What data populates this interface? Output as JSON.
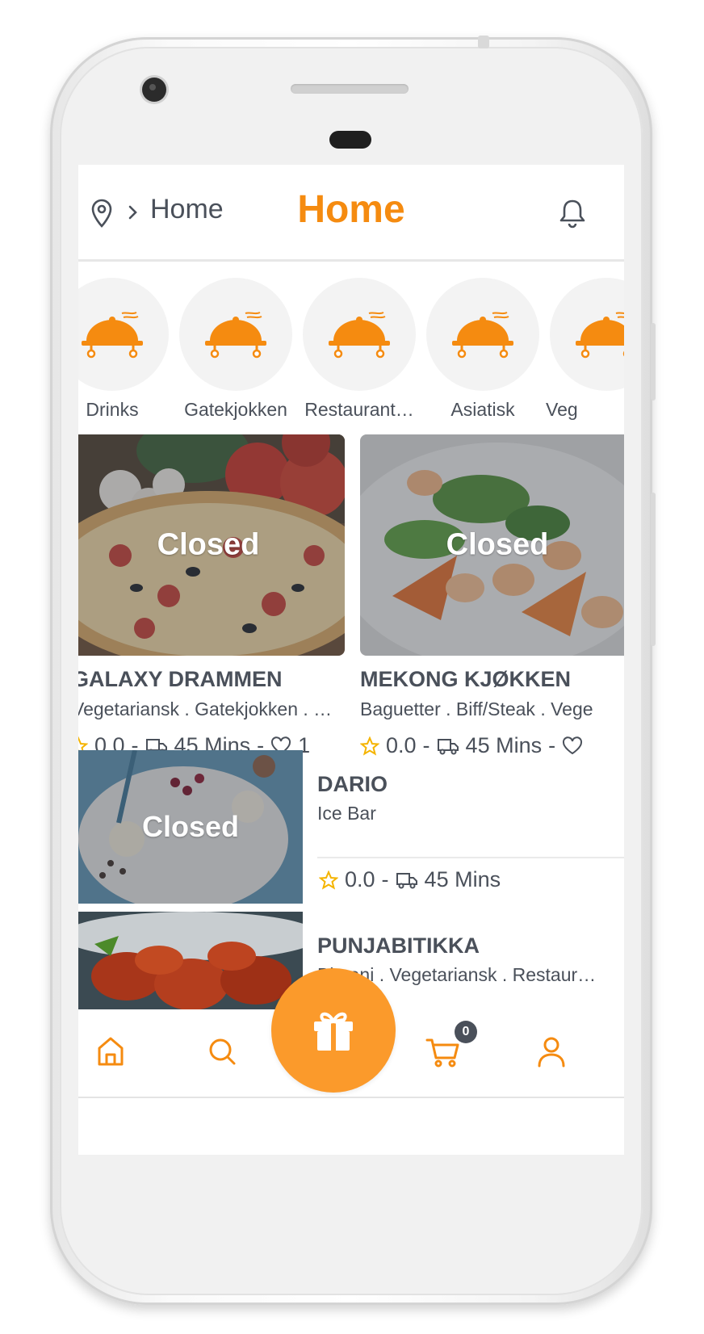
{
  "header": {
    "location_label": "Home",
    "title": "Home"
  },
  "categories": [
    {
      "label": "Drinks"
    },
    {
      "label": "Gatekjokken"
    },
    {
      "label": "Restaurant…"
    },
    {
      "label": "Asiatisk"
    },
    {
      "label": "Veg"
    }
  ],
  "featured": [
    {
      "status": "Closed",
      "name": "GALAXY DRAMMEN",
      "tags": "Vegetariansk . Gatekjokken . St…",
      "rating": "0.0",
      "time": "45 Mins",
      "likes": "1"
    },
    {
      "status": "Closed",
      "name": "MEKONG KJØKKEN",
      "tags": "Baguetter . Biff/Steak . Vege",
      "rating": "0.0",
      "time": "45 Mins",
      "likes": ""
    }
  ],
  "list": [
    {
      "status": "Closed",
      "name": "DARIO",
      "tags": "Ice Bar",
      "rating": "0.0",
      "time": "45 Mins"
    },
    {
      "name": "PUNJABITIKKA",
      "tags": "Biryani . Vegetariansk . Restaur…"
    }
  ],
  "separator": "-",
  "cart": {
    "count": "0"
  },
  "colors": {
    "accent": "#f58b10",
    "fab": "#fb9a2b",
    "text": "#4a505a",
    "star": "#f5b400"
  },
  "icons": [
    "location-icon",
    "chevron-right-icon",
    "bell-icon",
    "cloche-icon",
    "star-icon",
    "truck-icon",
    "heart-icon",
    "home-icon",
    "search-icon",
    "gift-icon",
    "cart-icon",
    "user-icon"
  ]
}
